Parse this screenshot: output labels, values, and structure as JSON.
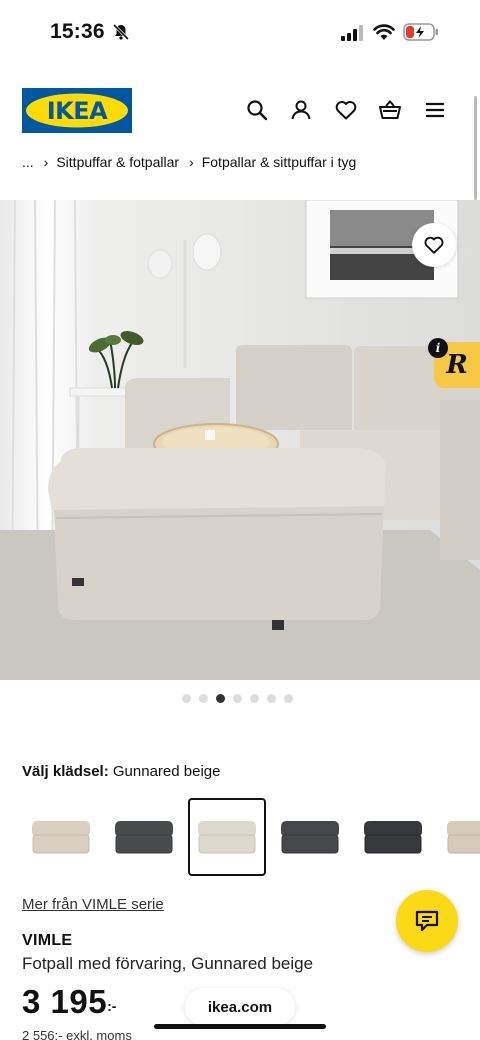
{
  "status_bar": {
    "time": "15:36"
  },
  "header": {
    "logo_text": "IKEA"
  },
  "breadcrumb": {
    "root": "...",
    "items": [
      "Sittpuffar & fotpallar",
      "Fotpallar & sittpuffar i tyg"
    ]
  },
  "gallery": {
    "total": 7,
    "active_index": 2
  },
  "options": {
    "label": "Välj klädsel:",
    "selected_value": "Gunnared beige",
    "swatches": [
      {
        "color": "#d9d0c2"
      },
      {
        "color": "#4a4b4d"
      },
      {
        "color": "#dcd8cd",
        "selected": true
      },
      {
        "color": "#45474a"
      },
      {
        "color": "#36383b"
      },
      {
        "color": "#d6cbb9"
      }
    ]
  },
  "series_link": "Mer från VIMLE serie",
  "product": {
    "name": "VIMLE",
    "description": "Fotpall med förvaring, Gunnared beige",
    "price": "3 195",
    "price_suffix": ":-",
    "price_ex_vat": "2 556:- exkl. moms"
  },
  "browser": {
    "url": "ikea.com"
  },
  "colors": {
    "brand_blue": "#0058a3",
    "brand_yellow": "#ffdb00",
    "chat_yellow": "#fbd914"
  },
  "icons": [
    "bell-off-icon",
    "signal-icon",
    "wifi-icon",
    "battery-icon",
    "search-icon",
    "user-icon",
    "heart-icon",
    "basket-icon",
    "menu-icon",
    "chevron-right-icon",
    "chat-icon"
  ]
}
